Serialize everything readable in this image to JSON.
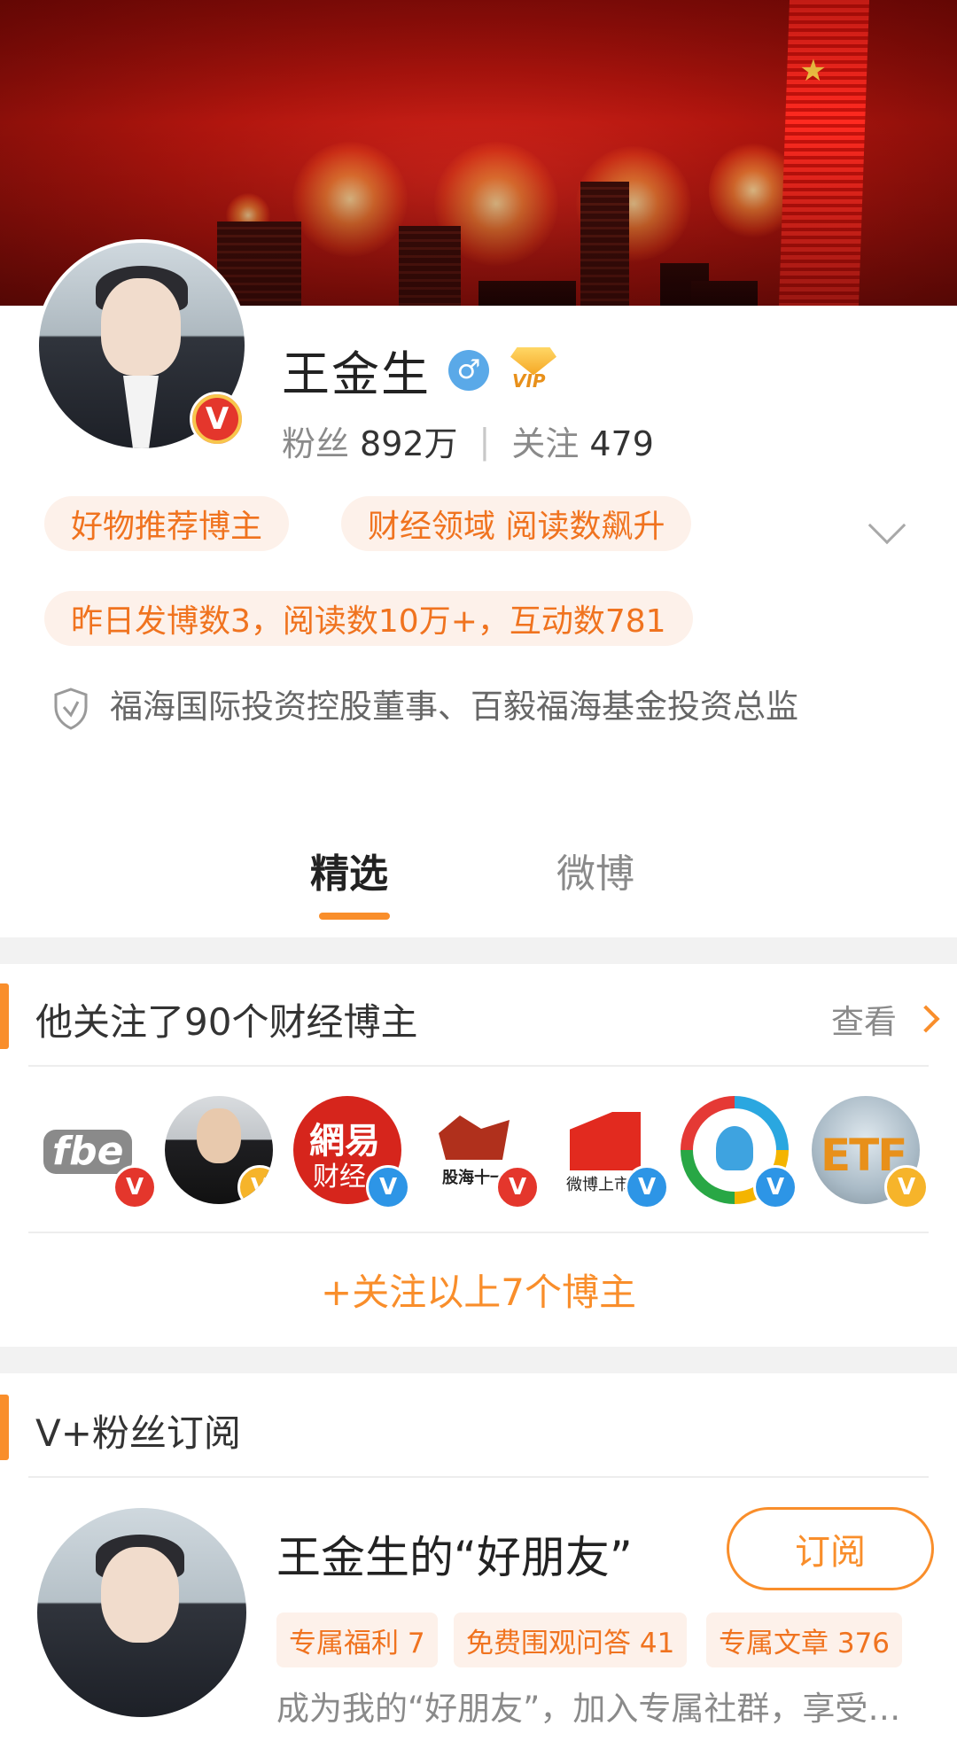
{
  "profile": {
    "name": "王金生",
    "fans_label": "粉丝",
    "fans_value": "892万",
    "stat_separator": "|",
    "follow_label": "关注",
    "follow_value": "479",
    "vip_text": "VIP",
    "gender_symbol": "♂",
    "verified_badge": "V",
    "tags": [
      "好物推荐博主",
      "财经领域 阅读数飙升"
    ],
    "stats_tag": "昨日发博数3，阅读数10万+，互动数781",
    "verification": "福海国际投资控股董事、百毅福海基金投资总监"
  },
  "tabs": [
    {
      "label": "精选",
      "active": true
    },
    {
      "label": "微博",
      "active": false
    }
  ],
  "following_section": {
    "title": "他关注了90个财经博主",
    "view_more": "查看",
    "bloggers": [
      {
        "logo_text": "fbe",
        "badge": "V",
        "badge_color": "red"
      },
      {
        "logo_text": "",
        "badge": "V",
        "badge_color": "gold"
      },
      {
        "logo_text": "網易",
        "logo_text2": "财经",
        "badge": "V",
        "badge_color": "blue"
      },
      {
        "logo_text": "股海十一",
        "badge": "V",
        "badge_color": "red"
      },
      {
        "logo_text": "微博上市",
        "badge": "V",
        "badge_color": "blue"
      },
      {
        "logo_text": "",
        "badge": "V",
        "badge_color": "blue"
      },
      {
        "logo_text": "ETF",
        "badge": "V",
        "badge_color": "gold"
      }
    ],
    "follow_all": "+关注以上7个博主"
  },
  "subscription_section": {
    "title": "V+粉丝订阅",
    "card_title": "王金生的“好朋友”",
    "subscribe_button": "订阅",
    "chips": [
      "专属福利 7",
      "免费围观问答 41",
      "专属文章 376"
    ],
    "description": "成为我的“好朋友”，加入专属社群，享受专属福利"
  },
  "colors": {
    "accent": "#f98e2b",
    "tag_text": "#f0731f",
    "tag_bg": "#fdf1ea",
    "verified_red": "#e4362c",
    "verified_blue": "#2d95e6",
    "verified_gold": "#f6b42a"
  }
}
